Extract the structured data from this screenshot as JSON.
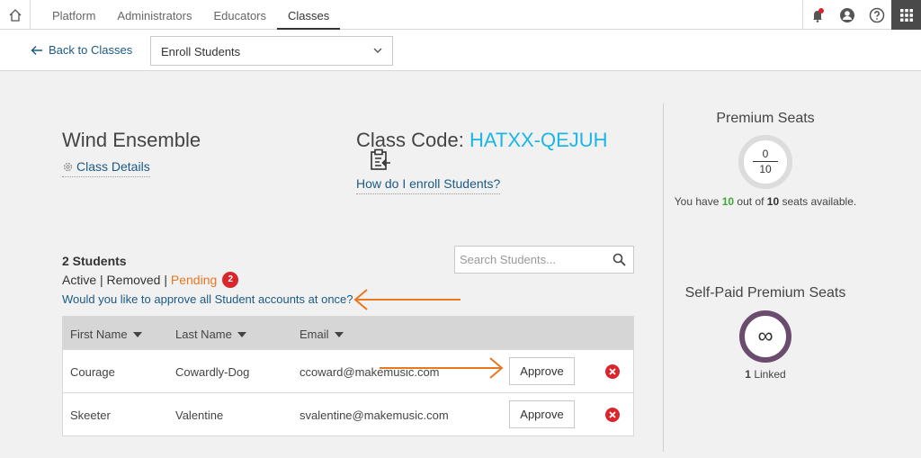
{
  "nav": {
    "tabs": [
      {
        "label": "Platform"
      },
      {
        "label": "Administrators"
      },
      {
        "label": "Educators"
      },
      {
        "label": "Classes"
      }
    ]
  },
  "subbar": {
    "back_label": "Back to Classes",
    "select_value": "Enroll Students"
  },
  "class": {
    "title": "Wind Ensemble",
    "details_label": "Class Details",
    "code_label": "Class Code:",
    "code": "HATXX-QEJUH",
    "help_link": "How do I enroll Students?"
  },
  "students": {
    "count_label": "2 Students",
    "filter_active": "Active",
    "filter_sep": " | ",
    "filter_removed": "Removed",
    "filter_pending": "Pending",
    "pending_count": "2",
    "approve_all": "Would you like to approve all Student accounts at once?",
    "search_placeholder": "Search Students...",
    "columns": [
      "First Name",
      "Last Name",
      "Email"
    ],
    "rows": [
      {
        "first": "Courage",
        "last": "Cowardly-Dog",
        "email": "ccoward@makemusic.com",
        "action": "Approve"
      },
      {
        "first": "Skeeter",
        "last": "Valentine",
        "email": "svalentine@makemusic.com",
        "action": "Approve"
      }
    ]
  },
  "premium": {
    "title": "Premium Seats",
    "used": "0",
    "total": "10",
    "text_prefix": "You have ",
    "available": "10",
    "text_mid": " out of ",
    "text_total": "10",
    "text_suffix": " seats available."
  },
  "self_paid": {
    "title": "Self-Paid Premium Seats",
    "symbol": "∞",
    "linked_count": "1",
    "linked_label": " Linked"
  },
  "colors": {
    "link": "#1b5a86",
    "code": "#1ab7e6",
    "pending": "#e87722",
    "badge": "#d9262c",
    "annotation_arrow": "#e87722"
  }
}
